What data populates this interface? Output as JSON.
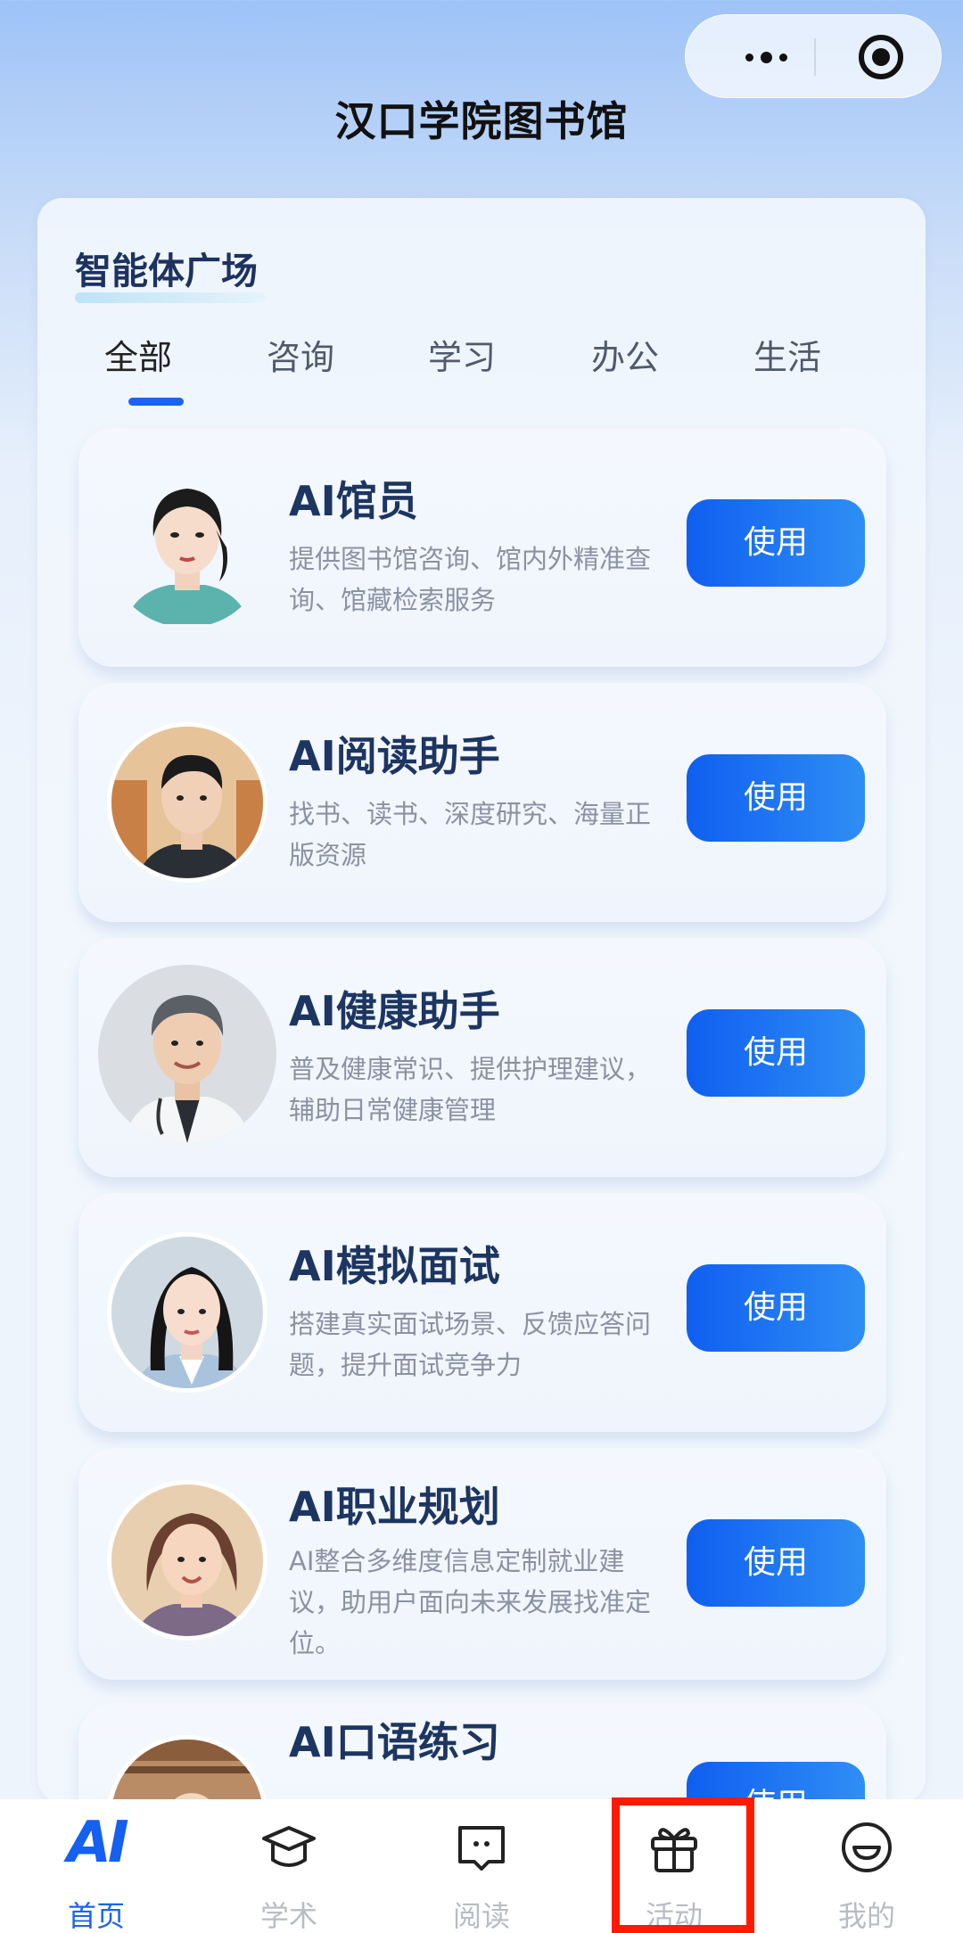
{
  "header": {
    "title": "汉口学院图书馆"
  },
  "section": {
    "title": "智能体广场"
  },
  "tabs": [
    "全部",
    "咨询",
    "学习",
    "办公",
    "生活"
  ],
  "agents": [
    {
      "name": "AI馆员",
      "desc": "提供图书馆咨询、馆内外精准查询、馆藏检索服务",
      "button": "使用"
    },
    {
      "name": "AI阅读助手",
      "desc": "找书、读书、深度研究、海量正版资源",
      "button": "使用"
    },
    {
      "name": "AI健康助手",
      "desc": "普及健康常识、提供护理建议，辅助日常健康管理",
      "button": "使用"
    },
    {
      "name": "AI模拟面试",
      "desc": "搭建真实面试场景、反馈应答问题，提升面试竞争力",
      "button": "使用"
    },
    {
      "name": "AI职业规划",
      "desc": "AI整合多维度信息定制就业建议，助用户面向未来发展找准定位。",
      "button": "使用"
    },
    {
      "name": "AI口语练习",
      "desc": "",
      "button": "使用"
    }
  ],
  "nav": {
    "logo_text": "AI",
    "items": [
      {
        "label": "首页",
        "icon": "ai-logo-icon"
      },
      {
        "label": "学术",
        "icon": "graduation-cap-icon"
      },
      {
        "label": "阅读",
        "icon": "book-icon"
      },
      {
        "label": "活动",
        "icon": "gift-icon"
      },
      {
        "label": "我的",
        "icon": "smiley-icon"
      }
    ]
  },
  "colors": {
    "accent": "#1a64f0",
    "highlight": "#ff1a00",
    "title": "#1d3561"
  }
}
